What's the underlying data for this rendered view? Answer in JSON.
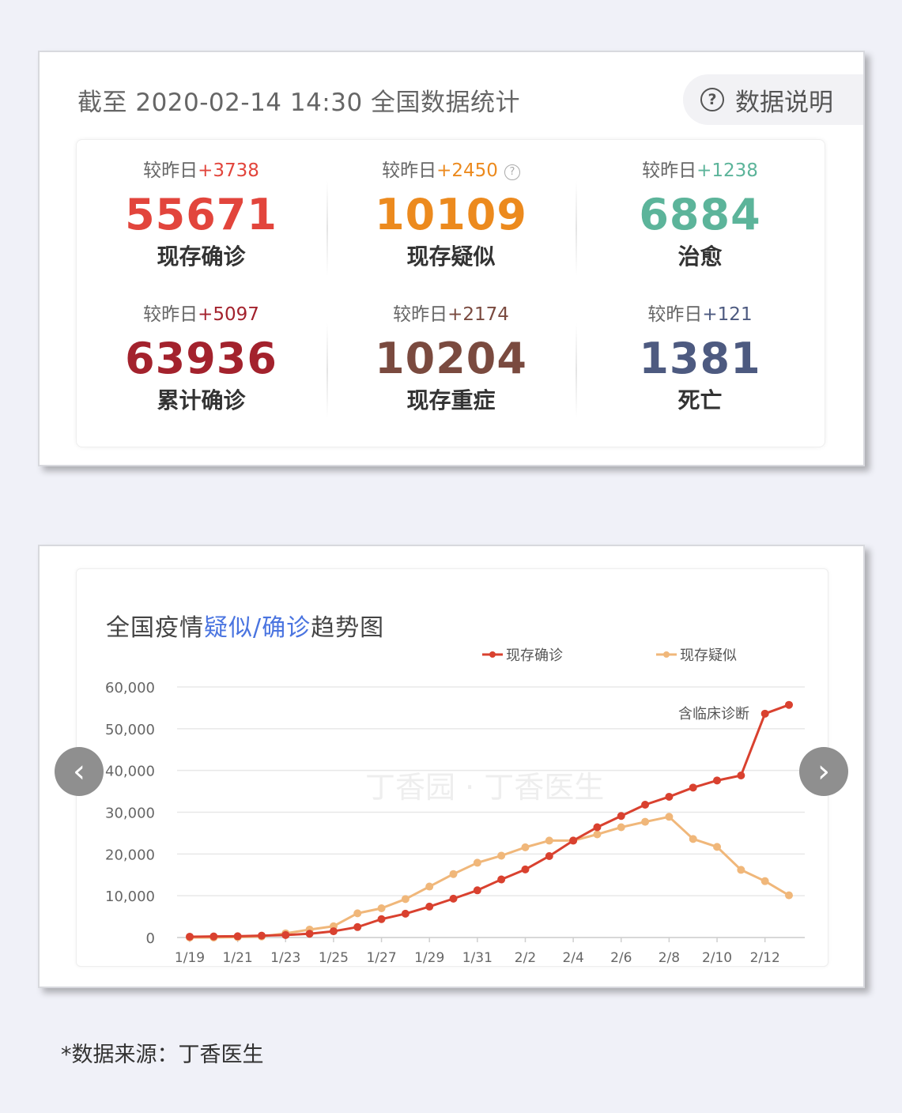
{
  "stats": {
    "title": "截至 2020-02-14 14:30 全国数据统计",
    "help_label": "数据说明",
    "items": [
      {
        "delta_prefix": "较昨日",
        "delta": "+3738",
        "value": "55671",
        "name": "现存确诊",
        "color": "#e2453c"
      },
      {
        "delta_prefix": "较昨日",
        "delta": "+2450",
        "value": "10109",
        "name": "现存疑似",
        "color": "#ec8a1e",
        "info_icon": "question-circle-icon"
      },
      {
        "delta_prefix": "较昨日",
        "delta": "+1238",
        "value": "6884",
        "name": "治愈",
        "color": "#5cb49a"
      },
      {
        "delta_prefix": "较昨日",
        "delta": "+5097",
        "value": "63936",
        "name": "累计确诊",
        "color": "#a3222d"
      },
      {
        "delta_prefix": "较昨日",
        "delta": "+2174",
        "value": "10204",
        "name": "现存重症",
        "color": "#7a4a3f"
      },
      {
        "delta_prefix": "较昨日",
        "delta": "+121",
        "value": "1381",
        "name": "死亡",
        "color": "#4d5a80"
      }
    ]
  },
  "chart_title": {
    "part1": "全国疫情",
    "highlight": "疑似/确诊",
    "part2": "趋势图"
  },
  "chart_data": {
    "type": "line",
    "title": "全国疫情疑似/确诊趋势图",
    "x": [
      "1/19",
      "1/20",
      "1/21",
      "1/22",
      "1/23",
      "1/24",
      "1/25",
      "1/26",
      "1/27",
      "1/28",
      "1/29",
      "1/30",
      "1/31",
      "2/1",
      "2/2",
      "2/3",
      "2/4",
      "2/5",
      "2/6",
      "2/7",
      "2/8",
      "2/9",
      "2/10",
      "2/11",
      "2/12",
      "2/13"
    ],
    "x_tick_labels": [
      "1/19",
      "1/21",
      "1/23",
      "1/25",
      "1/27",
      "1/29",
      "1/31",
      "2/2",
      "2/4",
      "2/6",
      "2/8",
      "2/10",
      "2/12"
    ],
    "y_tick_labels": [
      "0",
      "10,000",
      "20,000",
      "30,000",
      "40,000",
      "50,000",
      "60,000"
    ],
    "ylim": [
      0,
      60000
    ],
    "legend_position": "top",
    "grid": true,
    "series": [
      {
        "name": "现存确诊",
        "color": "#d9412f",
        "values": [
          200,
          250,
          300,
          450,
          600,
          900,
          1500,
          2500,
          4400,
          5700,
          7400,
          9300,
          11300,
          13900,
          16300,
          19500,
          23200,
          26400,
          29100,
          31800,
          33700,
          35900,
          37600,
          38800,
          53600,
          55700
        ]
      },
      {
        "name": "现存疑似",
        "color": "#f0b77a",
        "values": [
          0,
          0,
          100,
          250,
          1000,
          1900,
          2700,
          5800,
          7000,
          9200,
          12200,
          15200,
          17900,
          19600,
          21600,
          23200,
          23200,
          24700,
          26400,
          27700,
          28900,
          23600,
          21700,
          16200,
          13500,
          10100
        ]
      }
    ],
    "annotation": "含临床诊断",
    "watermark": "丁香园 · 丁香医生"
  },
  "nav": {
    "prev": "‹",
    "next": "›"
  },
  "footnote": "*数据来源：丁香医生"
}
